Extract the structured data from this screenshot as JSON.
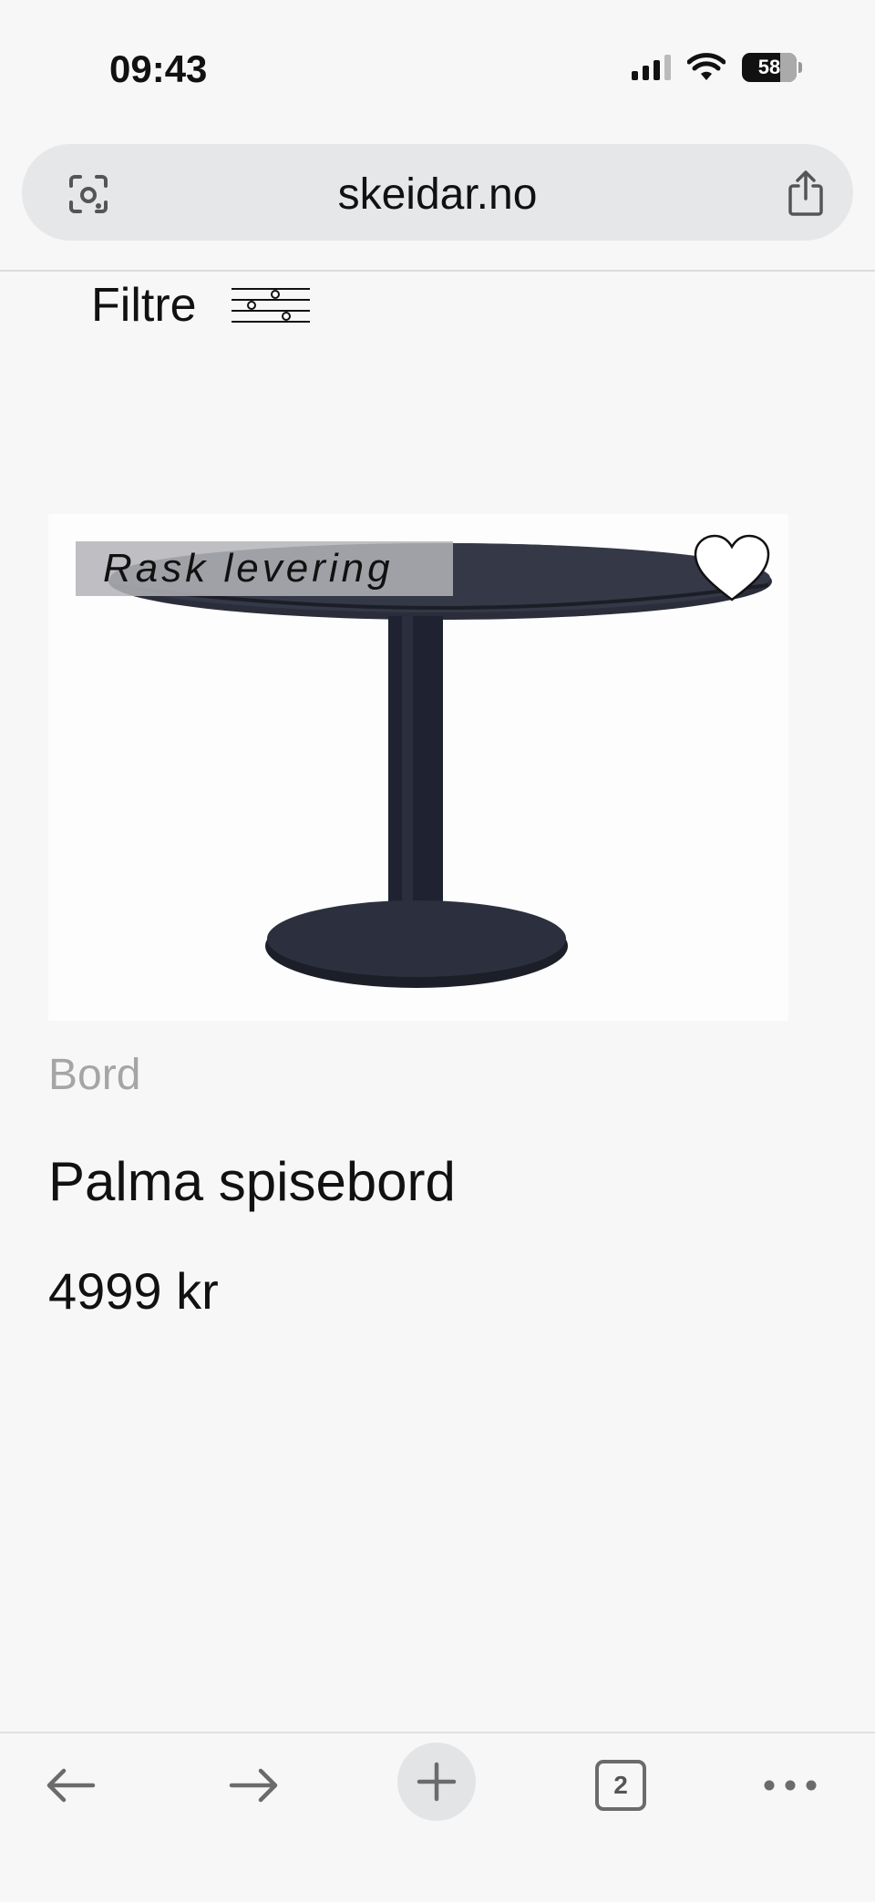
{
  "status_bar": {
    "time": "09:43",
    "battery": "58"
  },
  "browser": {
    "url": "skeidar.no",
    "tab_count": "2"
  },
  "filter": {
    "label": "Filtre"
  },
  "product": {
    "badge": "Rask levering",
    "category": "Bord",
    "name": "Palma spisebord",
    "price": "4999 kr"
  },
  "icons": {
    "lens": "camera-lens-icon",
    "share": "share-icon",
    "filter": "sliders-icon",
    "favorite": "heart-icon",
    "back": "arrow-left-icon",
    "forward": "arrow-right-icon",
    "new_tab": "plus-icon",
    "more": "ellipsis-icon"
  }
}
